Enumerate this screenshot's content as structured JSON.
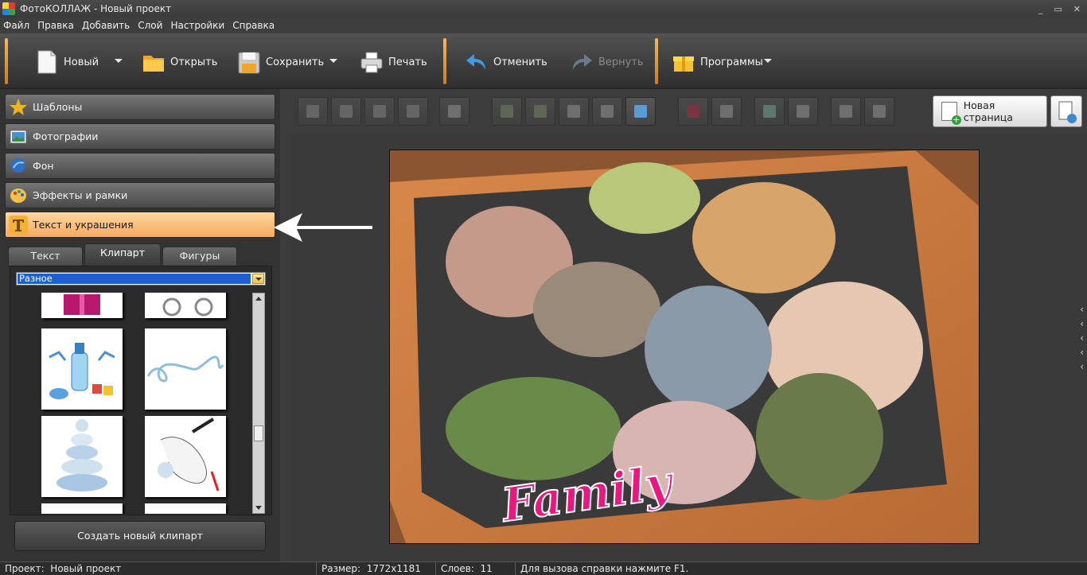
{
  "window": {
    "title": "ФотоКОЛЛАЖ - Новый проект",
    "controls": [
      "_",
      "▭",
      "✕"
    ]
  },
  "menu": [
    "Файл",
    "Правка",
    "Добавить",
    "Слой",
    "Настройки",
    "Справка"
  ],
  "toolbar": {
    "new_label": "Новый",
    "open_label": "Открыть",
    "save_label": "Сохранить",
    "print_label": "Печать",
    "undo_label": "Отменить",
    "redo_label": "Вернуть",
    "programs_label": "Программы"
  },
  "sidebar": {
    "items": [
      {
        "label": "Шаблоны",
        "icon": "star-icon"
      },
      {
        "label": "Фотографии",
        "icon": "photos-icon"
      },
      {
        "label": "Фон",
        "icon": "background-icon"
      },
      {
        "label": "Эффекты и рамки",
        "icon": "palette-icon"
      },
      {
        "label": "Текст и украшения",
        "icon": "text-icon",
        "active": true
      }
    ],
    "tabs": [
      {
        "label": "Текст"
      },
      {
        "label": "Клипарт",
        "active": true
      },
      {
        "label": "Фигуры"
      }
    ],
    "category_value": "Разное",
    "clipart_items": [
      "gift-box",
      "stroller-wheels",
      "baby-bottle-set",
      "ribbon",
      "ring-pyramid",
      "stork",
      "hanger",
      "blank"
    ],
    "create_clipart_label": "Создать новый клипарт"
  },
  "editor": {
    "new_page_label": "Новая страница",
    "canvas_text": "Family"
  },
  "status": {
    "project_label": "Проект:",
    "project_value": "Новый проект",
    "size_label": "Размер:",
    "size_value": "1772x1181",
    "layers_label": "Слоев:",
    "layers_value": "11",
    "help_text": "Для вызова справки нажмите F1."
  },
  "colors": {
    "accent": "#f6a95c",
    "selection": "#1f5fcf",
    "title_pink": "#e8187e"
  }
}
